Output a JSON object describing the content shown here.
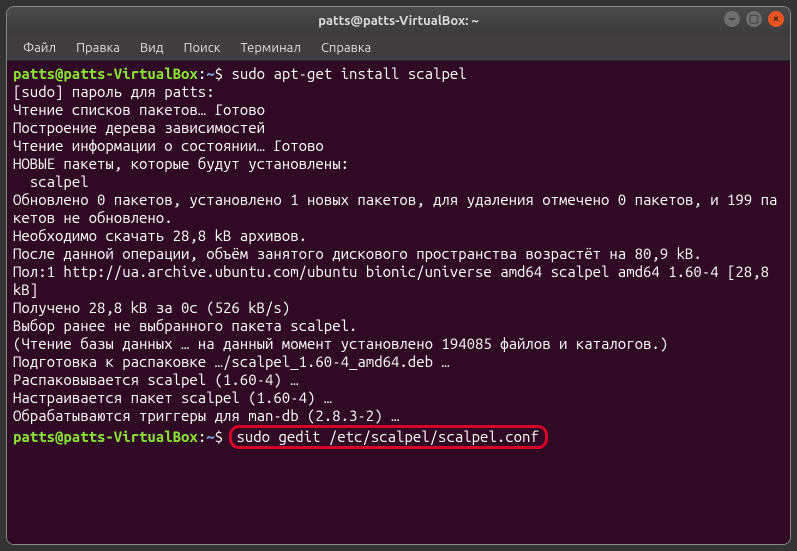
{
  "window": {
    "title": "patts@patts-VirtualBox: ~"
  },
  "menu": {
    "items": [
      "Файл",
      "Правка",
      "Вид",
      "Поиск",
      "Терминал",
      "Справка"
    ]
  },
  "prompt": {
    "userhost": "patts@patts-VirtualBox",
    "path": "~",
    "symbol": "$"
  },
  "terminal": {
    "cmd1": "sudo apt-get install scalpel",
    "cmd2": "sudo gedit /etc/scalpel/scalpel.conf",
    "lines": [
      "[sudo] пароль для patts:",
      "Чтение списков пакетов… Готово",
      "Построение дерева зависимостей",
      "Чтение информации о состоянии… Готово",
      "НОВЫЕ пакеты, которые будут установлены:",
      "  scalpel",
      "Обновлено 0 пакетов, установлено 1 новых пакетов, для удаления отмечено 0 пакетов, и 199 пакетов не обновлено.",
      "Необходимо скачать 28,8 kB архивов.",
      "После данной операции, объём занятого дискового пространства возрастёт на 80,9 kB.",
      "Пол:1 http://ua.archive.ubuntu.com/ubuntu bionic/universe amd64 scalpel amd64 1.60-4 [28,8 kB]",
      "Получено 28,8 kB за 0с (526 kB/s)",
      "Выбор ранее не выбранного пакета scalpel.",
      "(Чтение базы данных … на данный момент установлено 194085 файлов и каталогов.)",
      "Подготовка к распаковке …/scalpel_1.60-4_amd64.deb …",
      "Распаковывается scalpel (1.60-4) …",
      "Настраивается пакет scalpel (1.60-4) …",
      "Обрабатываются триггеры для man-db (2.8.3-2) …"
    ]
  }
}
